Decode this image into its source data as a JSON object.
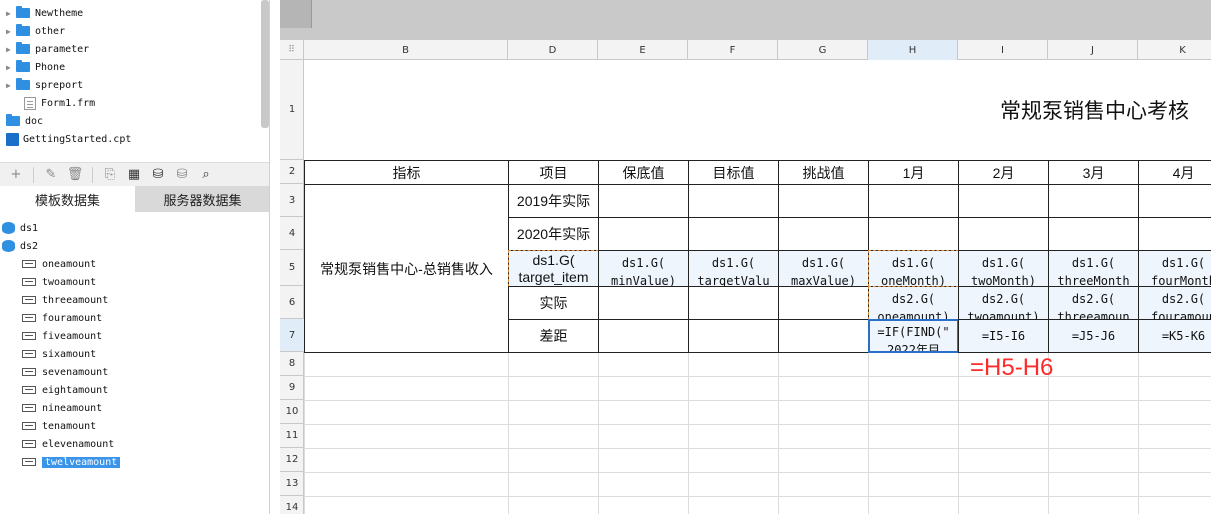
{
  "tree": {
    "items": [
      "Newtheme",
      "other",
      "parameter",
      "Phone",
      "spreport"
    ],
    "file": "Form1.frm",
    "doc": "doc",
    "cpt": "GettingStarted.cpt"
  },
  "tabs": {
    "template": "模板数据集",
    "server": "服务器数据集"
  },
  "datasets": {
    "ds1": "ds1",
    "ds2": "ds2",
    "fields": [
      "oneamount",
      "twoamount",
      "threeamount",
      "fouramount",
      "fiveamount",
      "sixamount",
      "sevenamount",
      "eightamount",
      "nineamount",
      "tenamount",
      "elevenamount",
      "twelveamount"
    ],
    "selected_index": 11
  },
  "sheet": {
    "columns": [
      "B",
      "D",
      "E",
      "F",
      "G",
      "H",
      "I",
      "J",
      "K"
    ],
    "active_column": "H",
    "rows": [
      "1",
      "2",
      "3",
      "4",
      "5",
      "6",
      "7",
      "8",
      "9",
      "10",
      "11",
      "12",
      "13",
      "14"
    ],
    "active_row": "7",
    "title": "常规泵销售中心考核",
    "headers": [
      "指标",
      "项目",
      "保底值",
      "目标值",
      "挑战值",
      "1月",
      "2月",
      "3月",
      "4月"
    ],
    "indicator": "常规泵销售中心-总销售收入",
    "items": [
      "2019年实际",
      "2020年实际",
      "ds1.G(\ntarget_item",
      "实际",
      "差距"
    ],
    "row5": [
      "ds1.G(\nminValue)",
      "ds1.G(\ntargetValu",
      "ds1.G(\nmaxValue)",
      "ds1.G(\noneMonth)",
      "ds1.G(\ntwoMonth)",
      "ds1.G(\nthreeMonth",
      "ds1.G(\nfourMonth"
    ],
    "row6": [
      "ds2.G(\noneamount)",
      "ds2.G(\ntwoamount)",
      "ds2.G(\nthreeamoun",
      "ds2.G(\nfouramoun"
    ],
    "row7": [
      "=IF(FIND(\"\n2022年目",
      "=I5-I6",
      "=J5-J6",
      "=K5-K6"
    ]
  },
  "annotation": "=H5-H6"
}
